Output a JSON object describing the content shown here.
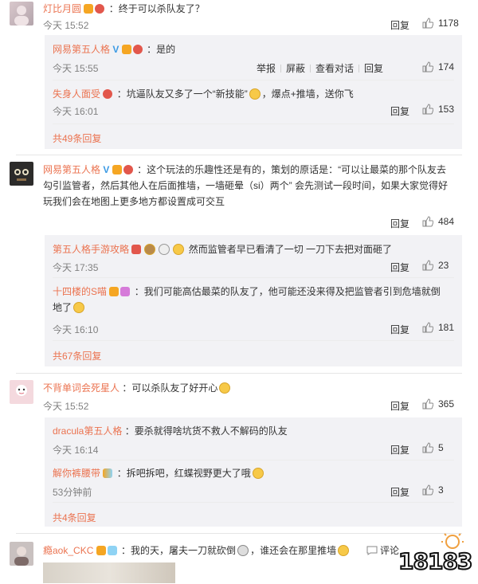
{
  "comments": [
    {
      "name": "灯比月圆",
      "text": "：终于可以杀队友了？",
      "time": "今天 15:52",
      "reply_label": "回复",
      "likes": "1178",
      "replies": [
        {
          "name": "网易第五人格",
          "text": "：是的",
          "time": "今天 15:55",
          "actions": [
            "举报",
            "屏蔽",
            "查看对话",
            "回复"
          ],
          "likes": "174"
        },
        {
          "name": "失身人面受",
          "text_before": "：坑逼队友又多了一个“新技能”",
          "text_after": "，爆点+推墙，送你飞",
          "time": "今天 16:01",
          "reply_label": "回复",
          "likes": "153"
        }
      ],
      "more": "共49条回复"
    },
    {
      "name": "网易第五人格",
      "text_lines": [
        "：这个玩法的乐趣性还是有的，策划的原话是：“可以让最菜的那个队友去",
        "勾引监管者，然后其他人在后面推墙，一墙砸晕（si）两个” 会先测试一段时间，如果大家觉得好",
        "玩我们会在地图上更多地方都设置成可交互"
      ],
      "reply_label": "回复",
      "likes": "484",
      "replies": [
        {
          "name": "第五人格手游攻略",
          "text": "然而监管者早已看清了一切 一刀下去把对面砸了",
          "time": "今天 17:35",
          "reply_label": "回复",
          "likes": "23"
        },
        {
          "name": "十四楼的S喵",
          "text_line1": "：我们可能高估最菜的队友了，他可能还没来得及把监管者引到危墙就倒",
          "text_line2": "地了",
          "time": "今天 16:10",
          "reply_label": "回复",
          "likes": "181"
        }
      ],
      "more": "共67条回复"
    },
    {
      "name": "不背单词会死星人",
      "text": "：可以杀队友了好开心",
      "time": "今天 15:52",
      "reply_label": "回复",
      "likes": "365",
      "replies": [
        {
          "name": "dracula第五人格",
          "text": "：要杀就得啥坑货不救人不解码的队友",
          "time": "今天 16:14",
          "reply_label": "回复",
          "likes": "5"
        },
        {
          "name": "解你裤腰带",
          "text": "：拆吧拆吧，红蝶视野更大了哦",
          "time": "53分钟前",
          "reply_label": "回复",
          "likes": "3"
        }
      ],
      "more": "共4条回复"
    },
    {
      "name": "瘾aok_CKC",
      "text_before": "：我的天，屠夫一刀就砍倒",
      "text_after": "，谁还会在那里推墙",
      "side": "评论"
    }
  ],
  "watermark": "18183",
  "colors": {
    "name": "#eb7350",
    "sub_bg": "#f2f2f5",
    "text": "#333333",
    "time": "#808080"
  }
}
